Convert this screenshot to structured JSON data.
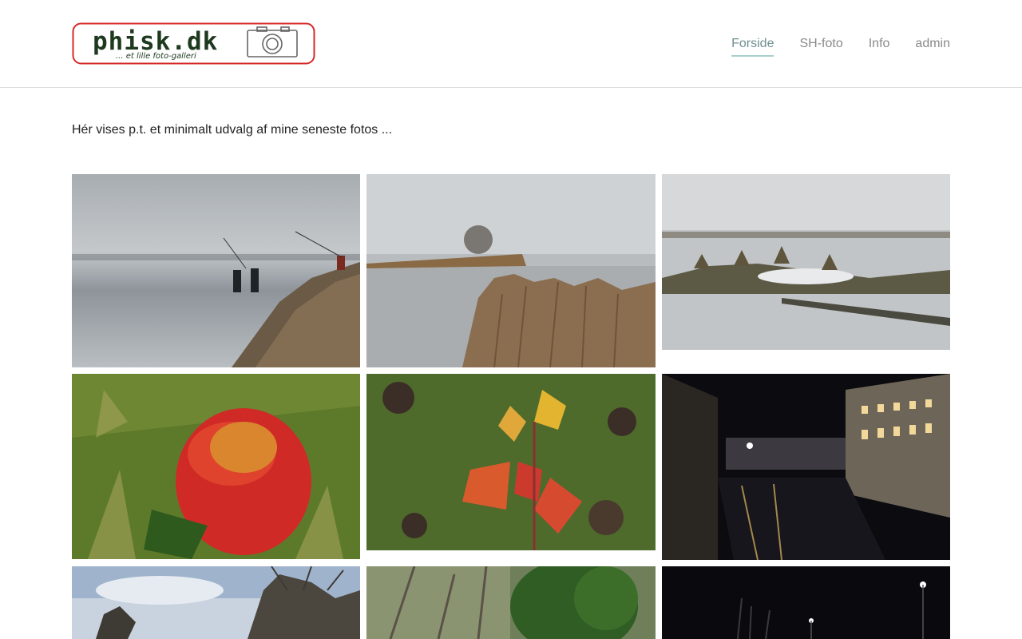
{
  "site": {
    "logo_text": "phisk.dk",
    "logo_tagline": "... et lille foto-galleri"
  },
  "nav": {
    "items": [
      {
        "label": "Forside",
        "active": true
      },
      {
        "label": "SH-foto",
        "active": false
      },
      {
        "label": "Info",
        "active": false
      },
      {
        "label": "admin",
        "active": false
      }
    ]
  },
  "intro": {
    "text": "Hér vises p.t. et minimalt udvalg af mine seneste fotos ..."
  },
  "colors": {
    "nav_text": "#8a8a8a",
    "nav_active": "#6f8f8f",
    "nav_underline": "#a7cfcf",
    "logo_border": "#d62a2a",
    "logo_text": "#1e3a1e"
  }
}
